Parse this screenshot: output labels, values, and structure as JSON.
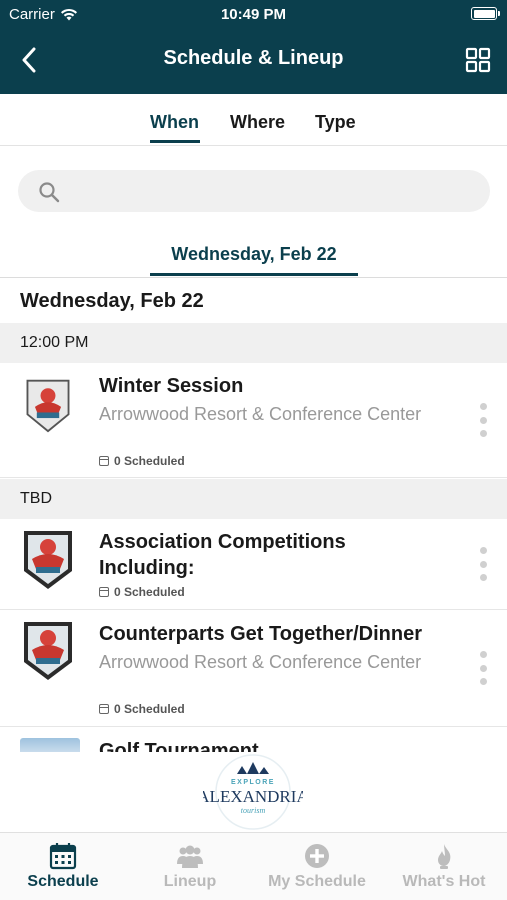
{
  "status_bar": {
    "carrier": "Carrier",
    "time": "10:49 PM"
  },
  "nav": {
    "title": "Schedule & Lineup"
  },
  "segments": [
    {
      "label": "When",
      "active": true
    },
    {
      "label": "Where",
      "active": false
    },
    {
      "label": "Type",
      "active": false
    }
  ],
  "search": {
    "placeholder": "",
    "value": ""
  },
  "date_tab": {
    "label": "Wednesday, Feb 22"
  },
  "day_heading": "Wednesday, Feb 22",
  "time_groups": [
    {
      "time": "12:00 PM",
      "events": [
        {
          "title": "Winter Session",
          "venue": "Arrowwood Resort & Conference Center",
          "scheduled": "0 Scheduled"
        }
      ]
    },
    {
      "time": "TBD",
      "events": [
        {
          "title": "Association Competitions Including:",
          "venue": "",
          "scheduled": "0 Scheduled"
        },
        {
          "title": "Counterparts Get Together/Dinner",
          "venue": "Arrowwood Resort & Conference Center",
          "scheduled": "0 Scheduled"
        },
        {
          "title": "Golf Tournament",
          "venue": "",
          "scheduled": ""
        }
      ]
    }
  ],
  "sponsor": {
    "line1": "EXPLORE",
    "line2": "ALEXANDRIA",
    "line3": "tourism"
  },
  "tabbar": [
    {
      "label": "Schedule",
      "icon": "calendar-icon",
      "active": true
    },
    {
      "label": "Lineup",
      "icon": "people-icon",
      "active": false
    },
    {
      "label": "My Schedule",
      "icon": "plus-circle-icon",
      "active": false
    },
    {
      "label": "What's Hot",
      "icon": "flame-icon",
      "active": false
    }
  ],
  "colors": {
    "primary": "#0b3f4d",
    "band": "#f0f0f0",
    "muted": "#999999",
    "inactive_tab": "#b9b9b9"
  }
}
